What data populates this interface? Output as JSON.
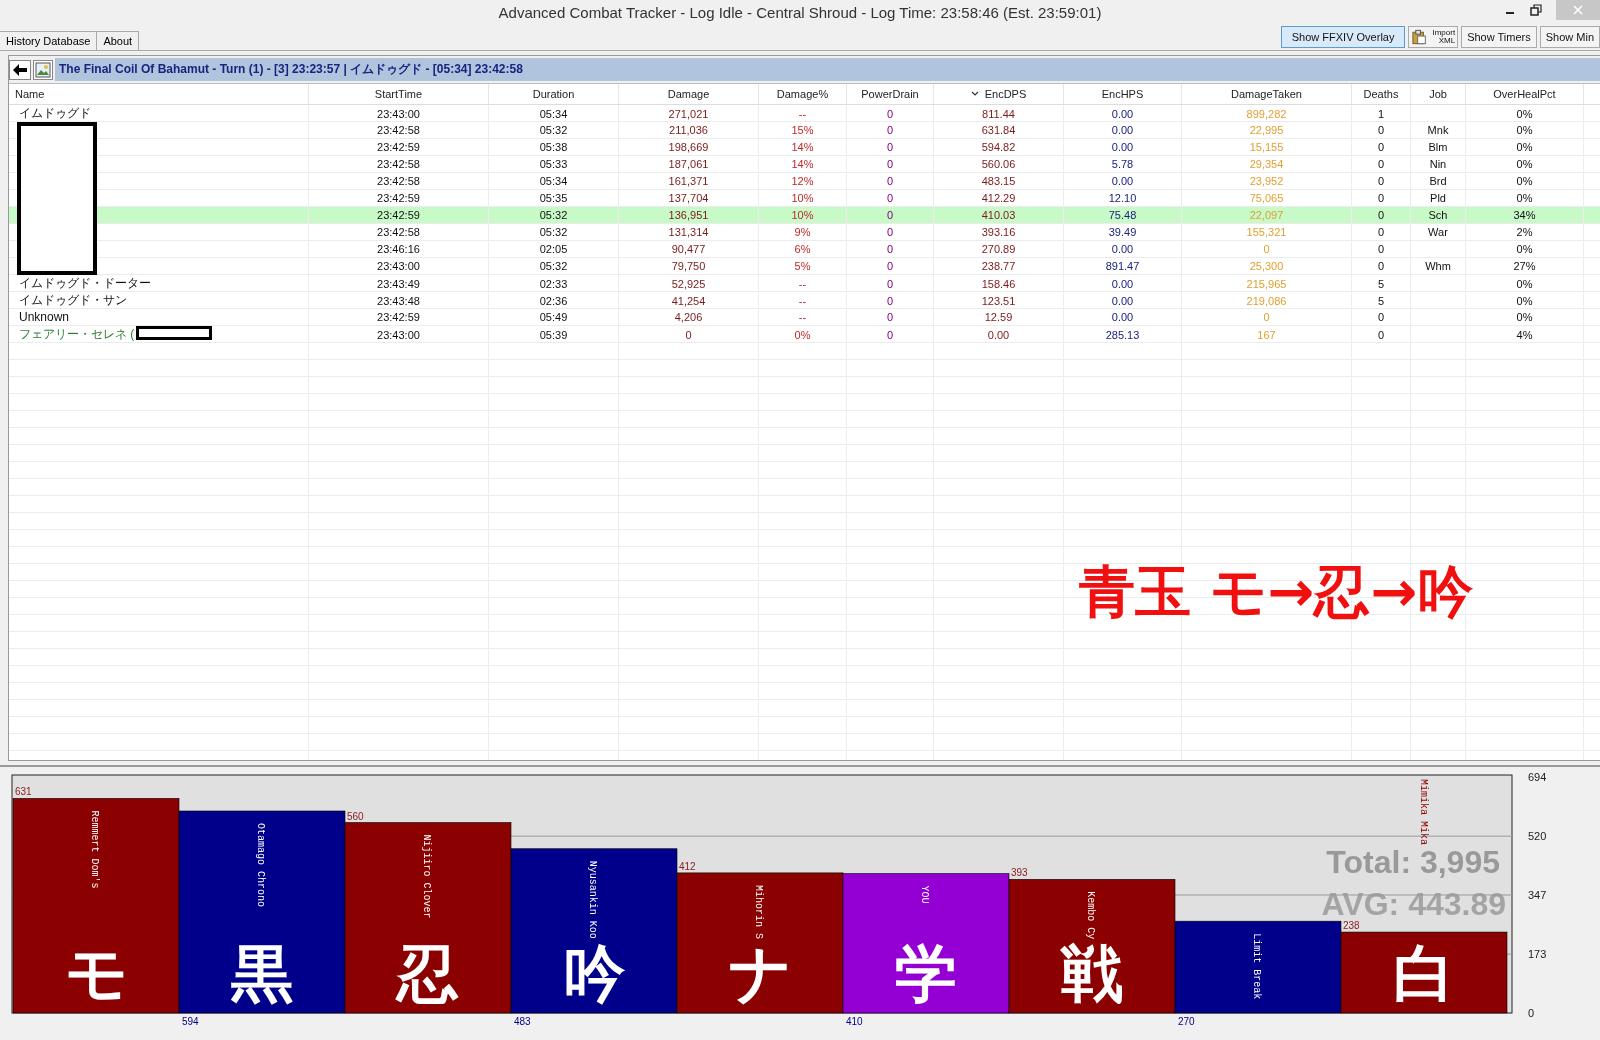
{
  "window": {
    "title": "Advanced Combat Tracker - Log Idle - Central Shroud - Log Time: 23:58:46 (Est. 23:59:01)"
  },
  "tabs": [
    {
      "label": "History Database",
      "selected": false
    },
    {
      "label": "About",
      "selected": false
    }
  ],
  "toolbar_buttons": [
    {
      "kind": "text",
      "label": "Show FFXIV Overlay",
      "selected": true
    },
    {
      "kind": "icon",
      "label": "Import XML",
      "selected": false
    },
    {
      "kind": "text",
      "label": "Show Timers",
      "selected": false
    },
    {
      "kind": "text",
      "label": "Show Min",
      "selected": false
    }
  ],
  "encounter_title": "The Final Coil Of Bahamut - Turn (1) - [3] 23:23:57 | イムドゥグド - [05:34] 23:42:58",
  "table": {
    "columns": [
      {
        "label": "Name",
        "sorted": false
      },
      {
        "label": "StartTime",
        "sorted": false
      },
      {
        "label": "Duration",
        "sorted": false
      },
      {
        "label": "Damage",
        "sorted": false
      },
      {
        "label": "Damage%",
        "sorted": false
      },
      {
        "label": "PowerDrain",
        "sorted": false
      },
      {
        "label": "EncDPS",
        "sorted": true
      },
      {
        "label": "EncHPS",
        "sorted": false
      },
      {
        "label": "DamageTaken",
        "sorted": false
      },
      {
        "label": "Deaths",
        "sorted": false
      },
      {
        "label": "Job",
        "sorted": false
      },
      {
        "label": "OverHealPct",
        "sorted": false
      }
    ],
    "rows": [
      {
        "kind": "combatant",
        "selected": false,
        "redacted": false,
        "name": "イムドゥグド",
        "start": "23:43:00",
        "duration": "05:34",
        "damage": "271,021",
        "damage_pct": "--",
        "power_drain": "0",
        "enc_dps": "811.44",
        "enc_hps": "0.00",
        "damage_taken": "899,282",
        "deaths": "1",
        "overheal": "0%"
      },
      {
        "kind": "combatant",
        "selected": false,
        "redacted": true,
        "start": "23:42:58",
        "duration": "05:32",
        "damage": "211,036",
        "damage_pct": "15%",
        "power_drain": "0",
        "enc_dps": "631.84",
        "enc_hps": "0.00",
        "damage_taken": "22,995",
        "deaths": "0",
        "job": "Mnk",
        "overheal": "0%"
      },
      {
        "kind": "combatant",
        "selected": false,
        "redacted": true,
        "start": "23:42:59",
        "duration": "05:38",
        "damage": "198,669",
        "damage_pct": "14%",
        "power_drain": "0",
        "enc_dps": "594.82",
        "enc_hps": "0.00",
        "damage_taken": "15,155",
        "deaths": "0",
        "job": "Blm",
        "overheal": "0%"
      },
      {
        "kind": "combatant",
        "selected": false,
        "redacted": true,
        "start": "23:42:58",
        "duration": "05:33",
        "damage": "187,061",
        "damage_pct": "14%",
        "power_drain": "0",
        "enc_dps": "560.06",
        "enc_hps": "5.78",
        "damage_taken": "29,354",
        "deaths": "0",
        "job": "Nin",
        "overheal": "0%"
      },
      {
        "kind": "combatant",
        "selected": false,
        "redacted": true,
        "start": "23:42:58",
        "duration": "05:34",
        "damage": "161,371",
        "damage_pct": "12%",
        "power_drain": "0",
        "enc_dps": "483.15",
        "enc_hps": "0.00",
        "damage_taken": "23,952",
        "deaths": "0",
        "job": "Brd",
        "overheal": "0%"
      },
      {
        "kind": "combatant",
        "selected": false,
        "redacted": true,
        "start": "23:42:59",
        "duration": "05:35",
        "damage": "137,704",
        "damage_pct": "10%",
        "power_drain": "0",
        "enc_dps": "412.29",
        "enc_hps": "12.10",
        "damage_taken": "75,065",
        "deaths": "0",
        "job": "Pld",
        "overheal": "0%"
      },
      {
        "kind": "combatant",
        "selected": true,
        "redacted": true,
        "start": "23:42:59",
        "duration": "05:32",
        "damage": "136,951",
        "damage_pct": "10%",
        "power_drain": "0",
        "enc_dps": "410.03",
        "enc_hps": "75.48",
        "damage_taken": "22,097",
        "deaths": "0",
        "job": "Sch",
        "overheal": "34%"
      },
      {
        "kind": "combatant",
        "selected": false,
        "redacted": true,
        "start": "23:42:58",
        "duration": "05:32",
        "damage": "131,314",
        "damage_pct": "9%",
        "power_drain": "0",
        "enc_dps": "393.16",
        "enc_hps": "39.49",
        "damage_taken": "155,321",
        "deaths": "0",
        "job": "War",
        "overheal": "2%"
      },
      {
        "kind": "combatant",
        "selected": false,
        "redacted": true,
        "start": "23:46:16",
        "duration": "02:05",
        "damage": "90,477",
        "damage_pct": "6%",
        "power_drain": "0",
        "enc_dps": "270.89",
        "enc_hps": "0.00",
        "damage_taken": "0",
        "deaths": "0",
        "overheal": "0%"
      },
      {
        "kind": "combatant",
        "selected": false,
        "redacted": true,
        "start": "23:43:00",
        "duration": "05:32",
        "damage": "79,750",
        "damage_pct": "5%",
        "power_drain": "0",
        "enc_dps": "238.77",
        "enc_hps": "891.47",
        "damage_taken": "25,300",
        "deaths": "0",
        "job": "Whm",
        "overheal": "27%"
      },
      {
        "kind": "combatant",
        "selected": false,
        "redacted": false,
        "name": "イムドゥグド・ドーター",
        "start": "23:43:49",
        "duration": "02:33",
        "damage": "52,925",
        "damage_pct": "--",
        "power_drain": "0",
        "enc_dps": "158.46",
        "enc_hps": "0.00",
        "damage_taken": "215,965",
        "deaths": "5",
        "overheal": "0%"
      },
      {
        "kind": "combatant",
        "selected": false,
        "redacted": false,
        "name": "イムドゥグド・サン",
        "start": "23:43:48",
        "duration": "02:36",
        "damage": "41,254",
        "damage_pct": "--",
        "power_drain": "0",
        "enc_dps": "123.51",
        "enc_hps": "0.00",
        "damage_taken": "219,086",
        "deaths": "5",
        "overheal": "0%"
      },
      {
        "kind": "combatant",
        "selected": false,
        "redacted": false,
        "name": "Unknown",
        "start": "23:42:59",
        "duration": "05:49",
        "damage": "4,206",
        "damage_pct": "--",
        "power_drain": "0",
        "enc_dps": "12.59",
        "enc_hps": "0.00",
        "damage_taken": "0",
        "deaths": "0",
        "overheal": "0%"
      },
      {
        "kind": "pet",
        "selected": false,
        "redacted": true,
        "name": "フェアリー・セレネ (",
        "start": "23:43:00",
        "duration": "05:39",
        "damage": "0",
        "damage_pct": "0%",
        "power_drain": "0",
        "enc_dps": "0.00",
        "enc_hps": "285.13",
        "damage_taken": "167",
        "deaths": "0",
        "overheal": "4%"
      }
    ]
  },
  "annotation": "青玉 モ→忍→吟",
  "chart": {
    "chart_data": {
      "type": "bar",
      "categories": [
        "Remmert Dom's",
        "Otamago Chrono",
        "Nijiiro Clover",
        "Nyusankin Koo",
        "Mihorin S",
        "YOU",
        "Kembo Cy",
        "Limit Break",
        "Mimika Mika"
      ],
      "series": [
        {
          "values": [
            631,
            594,
            560,
            483,
            412,
            410,
            393,
            270,
            238
          ]
        }
      ],
      "ylim": [
        0,
        694
      ],
      "yticks": [
        {
          "value": 0,
          "label": "0"
        },
        173,
        347,
        520,
        694
      ],
      "data_labels": true,
      "grid": true
    },
    "bars": [
      {
        "color": "#8b0000",
        "overlay": "モ",
        "label_on_top": false
      },
      {
        "color": "#00008b",
        "overlay": "黒",
        "label_on_top": false
      },
      {
        "color": "#8b0000",
        "overlay": "忍",
        "label_on_top": false
      },
      {
        "color": "#00008b",
        "overlay": "吟",
        "label_on_top": false
      },
      {
        "color": "#8b0000",
        "overlay": "ナ",
        "label_on_top": false
      },
      {
        "color": "#9400d3",
        "overlay": "学",
        "label_on_top": false
      },
      {
        "color": "#8b0000",
        "overlay": "戦",
        "label_on_top": false
      },
      {
        "color": "#00008b",
        "label_on_top": false
      },
      {
        "color": "#8b0000",
        "overlay": "白",
        "label_on_top": true
      }
    ],
    "total": "Total: 3,995",
    "avg": "AVG: 443.89"
  }
}
